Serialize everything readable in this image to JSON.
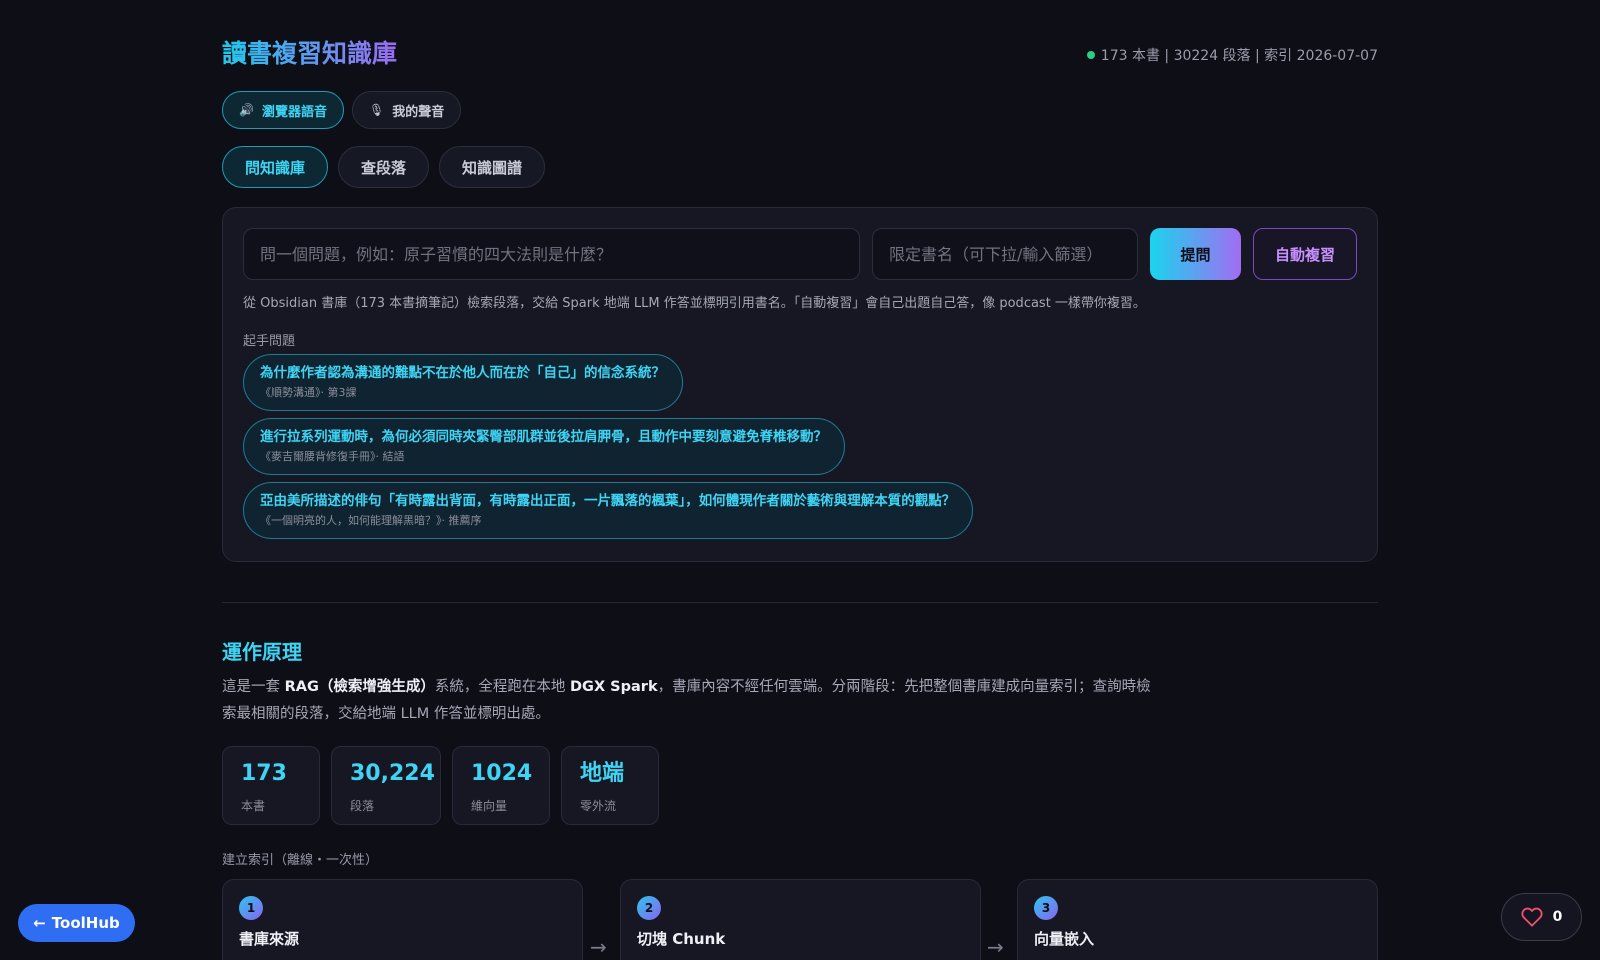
{
  "header": {
    "title": "讀書複習知識庫",
    "status": "173 本書 | 30224 段落 | 索引 2026-07-07",
    "status_color": "#2ad07e"
  },
  "voice": [
    {
      "icon": "speaker-icon",
      "label": "瀏覽器語音",
      "active": true
    },
    {
      "icon": "microphone-icon",
      "label": "我的聲音",
      "active": false
    }
  ],
  "tabs": [
    {
      "label": "問知識庫",
      "active": true
    },
    {
      "label": "查段落",
      "active": false
    },
    {
      "label": "知識圖譜",
      "active": false
    }
  ],
  "ask": {
    "question_placeholder": "問一個問題，例如：原子習慣的四大法則是什麼？",
    "book_placeholder": "限定書名（可下拉/輸入篩選）",
    "ask_label": "提問",
    "auto_label": "自動複習",
    "description": "從 Obsidian 書庫（173 本書摘筆記）檢索段落，交給 Spark 地端 LLM 作答並標明引用書名。「自動複習」會自己出題自己答，像 podcast 一樣帶你複習。",
    "starter_label": "起手問題",
    "starters": [
      {
        "question": "為什麼作者認為溝通的難點不在於他人而在於「自己」的信念系統？",
        "source": "《順勢溝通》· 第3課"
      },
      {
        "question": "進行拉系列運動時，為何必須同時夾緊臀部肌群並後拉肩胛骨，且動作中要刻意避免脊椎移動？",
        "source": "《麥吉爾腰背修復手冊》· 結語"
      },
      {
        "question": "亞由美所描述的俳句「有時露出背面，有時露出正面，一片飄落的楓葉」，如何體現作者關於藝術與理解本質的觀點？",
        "source": "《一個明亮的人，如何能理解黑暗？》· 推薦序"
      }
    ]
  },
  "how": {
    "title": "運作原理",
    "p1": "這是一套 ",
    "b1": "RAG（檢索增強生成）",
    "p2": "系統，全程跑在本地 ",
    "b2": "DGX Spark",
    "p3": "，書庫內容不經任何雲端。分兩階段：先把整個書庫建成向量索引；查詢時檢索最相關的段落，交給地端 LLM 作答並標明出處。",
    "stats": [
      {
        "num": "173",
        "label": "本書"
      },
      {
        "num": "30,224",
        "label": "段落"
      },
      {
        "num": "1024",
        "label": "維向量"
      },
      {
        "num": "地端",
        "label": "零外流"
      }
    ],
    "index_label": "建立索引（離線・一次性）",
    "steps": [
      {
        "n": "1",
        "title": "書庫來源"
      },
      {
        "n": "2",
        "title": "切塊 Chunk"
      },
      {
        "n": "3",
        "title": "向量嵌入"
      }
    ],
    "arrow": "→"
  },
  "footer": {
    "toolhub_label": "ToolHub",
    "like_count": "0"
  },
  "colors": {
    "accent": "#3fd4f4",
    "purple": "#a26cf2",
    "background": "#0d0e16"
  }
}
